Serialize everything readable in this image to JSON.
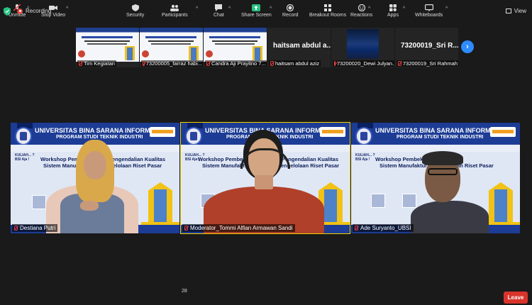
{
  "topbar": {
    "recording_label": "Recording",
    "view_label": "View"
  },
  "strip": {
    "thumbs": [
      {
        "name": "Tim Kegiatan"
      },
      {
        "name": "73200005_farraz habi..."
      },
      {
        "name": "Candra Aji Prayitno 7..."
      },
      {
        "name": "haitsam abdul aziz",
        "big": "haitsam abdul a..."
      },
      {
        "name": "73200020_Dewi Julyan..."
      },
      {
        "name": "73200019_Sri Rahmah",
        "big": "73200019_Sri R..."
      }
    ]
  },
  "gallery": {
    "slide_title": "UNIVERSITAS BINA SARANA INFORMATIKA",
    "slide_subtitle": "PROGRAM STUDI TEKNIK INDUSTRI",
    "kampus_label": "KAMPUS DIGITAL KREATIF",
    "kuliah_label": "KULIAH... ? BSI Aja !",
    "tiles": [
      {
        "name": "Destiana Putri",
        "w1": "Workshop Pembekalan S",
        "w1b": "Pengendalian Kualitas",
        "w2": "Sistem Manufaktu",
        "w2b": "Pengelolaan Riset Pasar"
      },
      {
        "name": "Moderator_Tommi Alfian Armawan Sandi",
        "w1": "Workshop Pembekal",
        "w1b": "Pengendalian Kualitas",
        "w2": "Sistem Manufakt",
        "w2b": "Pengelolaan Riset Pasar"
      },
      {
        "name": "Ade Suryanto_UBSI",
        "w1": "Workshop Pembekalan Sertifikas",
        "w1b": "",
        "w2": "Sistem Manufaktur dan",
        "w2b": "elolaan Riset Pasar"
      }
    ]
  },
  "toolbar": {
    "items": [
      "Unmute",
      "Stop Video",
      "Security",
      "Participants",
      "Chat",
      "Share Screen",
      "Record",
      "Breakout Rooms",
      "Reactions",
      "Apps",
      "Whiteboards"
    ],
    "participants_count": "28",
    "leave_label": "Leave"
  },
  "colors": {
    "accent": "#2d8cff",
    "leave": "#d9342b",
    "active_speaker": "#f4d000",
    "share": "#26c281"
  }
}
